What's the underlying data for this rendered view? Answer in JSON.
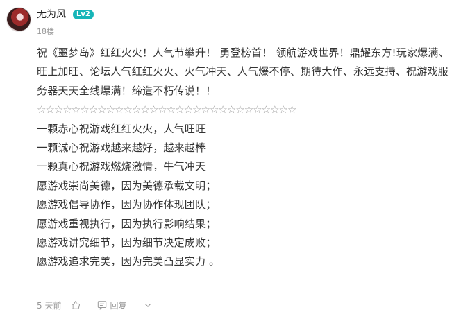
{
  "author": {
    "name": "无为风",
    "level": "Lv2"
  },
  "post": {
    "floor": "18楼",
    "paragraph": "祝《噩梦岛》红红火火！人气节攀升！ 勇登榜首！ 领航游戏世界！鼎耀东方!玩家爆满、旺上加旺、论坛人气红红火火、火气冲天、人气爆不停、期待大作、永远支持、祝游戏服务器天天全线爆满！缔造不朽传说！！",
    "stars": "☆☆☆☆☆☆☆☆☆☆☆☆☆☆☆☆☆☆☆☆☆☆☆☆☆☆☆☆☆☆",
    "lines": [
      "一颗赤心祝游戏红红火火，人气旺旺",
      "一颗诚心祝游戏越来越好，越来越棒",
      "一颗真心祝游戏燃烧激情，牛气冲天",
      "愿游戏崇尚美德，因为美德承载文明；",
      "愿游戏倡导协作，因为协作体现团队；",
      "愿游戏重视执行，因为执行影响结果；",
      "愿游戏讲究细节，因为细节决定成败；",
      "愿游戏追求完美，因为完美凸显实力 。"
    ]
  },
  "footer": {
    "time": "5 天前",
    "reply_label": "回复"
  },
  "icons": {
    "like": "thumbs-up-icon",
    "reply": "comment-icon",
    "more": "chevron-down-icon"
  },
  "colors": {
    "level_badge": "#17b5b8",
    "muted": "#999999"
  }
}
